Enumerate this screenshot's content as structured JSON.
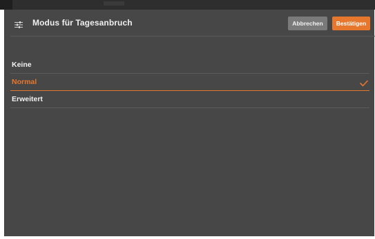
{
  "dialog": {
    "title": "Modus für Tagesanbruch",
    "icon": "sliders-icon",
    "buttons": {
      "cancel_label": "Abbrechen",
      "confirm_label": "Bestätigen"
    }
  },
  "options": [
    {
      "label": "Keine",
      "selected": false
    },
    {
      "label": "Normal",
      "selected": true
    },
    {
      "label": "Erweitert",
      "selected": false
    }
  ],
  "colors": {
    "accent": "#e8772e",
    "panel": "#474747",
    "cancel_button": "#7a7a7a",
    "text": "#f2f2f2"
  }
}
